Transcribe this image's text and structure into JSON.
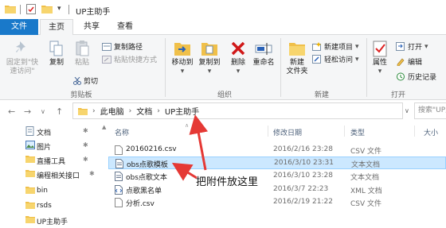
{
  "window": {
    "title": "UP主助手"
  },
  "tabs": [
    {
      "label": "文件"
    },
    {
      "label": "主页"
    },
    {
      "label": "共享"
    },
    {
      "label": "查看"
    }
  ],
  "ribbon": {
    "clipboard": {
      "pin_label_1": "固定到\"快",
      "pin_label_2": "速访问\"",
      "copy": "复制",
      "paste": "粘贴",
      "copy_path": "复制路径",
      "paste_shortcut": "粘贴快捷方式",
      "cut": "剪切",
      "group": "剪贴板"
    },
    "organize": {
      "move_to": "移动到",
      "copy_to": "复制到",
      "delete": "删除",
      "rename": "重命名",
      "group": "组织"
    },
    "new": {
      "new_folder_1": "新建",
      "new_folder_2": "文件夹",
      "new_item": "新建项目",
      "easy_access": "轻松访问",
      "group": "新建"
    },
    "open": {
      "properties": "属性",
      "open": "打开",
      "edit": "编辑",
      "history": "历史记录",
      "group": "打开"
    }
  },
  "address": {
    "crumbs": [
      "此电脑",
      "文档",
      "UP主助手"
    ],
    "search_placeholder": "搜索\"UP主"
  },
  "nav": {
    "items": [
      {
        "label": "文档",
        "pinned": true
      },
      {
        "label": "图片",
        "pinned": true
      },
      {
        "label": "直播工具",
        "pinned": true
      },
      {
        "label": "编程相关接口",
        "pinned": true
      },
      {
        "label": "bin",
        "pinned": false
      },
      {
        "label": "rsds",
        "pinned": false
      },
      {
        "label": "UP主助手",
        "pinned": false
      }
    ]
  },
  "files": {
    "columns": {
      "name": "名称",
      "date": "修改日期",
      "type": "类型",
      "size": "大小"
    },
    "rows": [
      {
        "name": "20160216.csv",
        "date": "2016/2/16 23:28",
        "type": "CSV 文件",
        "icon": "csv-file-icon"
      },
      {
        "name": "obs点歌模板",
        "date": "2016/3/10 23:31",
        "type": "文本文档",
        "icon": "text-file-icon",
        "selected": true
      },
      {
        "name": "obs点歌文本",
        "date": "2016/3/10 23:28",
        "type": "文本文档",
        "icon": "text-file-icon"
      },
      {
        "name": "点歌黑名单",
        "date": "2016/3/7 22:23",
        "type": "XML 文档",
        "icon": "xml-file-icon"
      },
      {
        "name": "分析.csv",
        "date": "2016/2/19 21:22",
        "type": "CSV 文件",
        "icon": "csv-file-icon"
      }
    ]
  },
  "annotation": {
    "text": "把附件放这里",
    "color": "#e53935"
  }
}
